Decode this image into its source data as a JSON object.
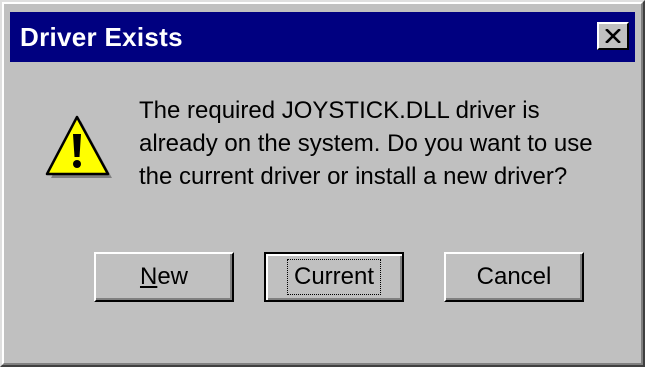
{
  "dialog": {
    "title": "Driver Exists",
    "icon": "warning-icon",
    "message": "The required JOYSTICK.DLL driver is already on the system. Do you want to use the current driver or install a new driver?"
  },
  "titlebar": {
    "close_icon": "close-icon",
    "color": "#000080"
  },
  "buttons": {
    "new": {
      "mnemonic": "N",
      "rest": "ew"
    },
    "current": {
      "label": "Current"
    },
    "cancel": {
      "label": "Cancel"
    }
  },
  "colors": {
    "face": "#c0c0c0",
    "warning_fill": "#ffff00"
  }
}
